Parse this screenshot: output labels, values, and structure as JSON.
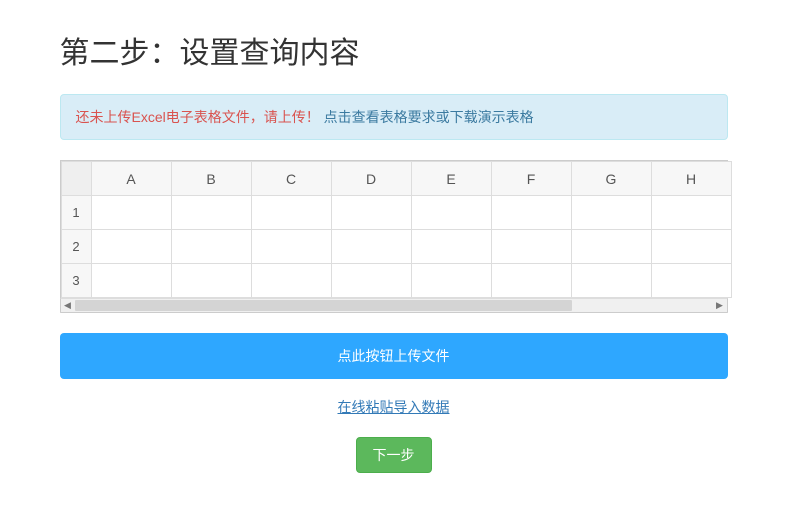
{
  "page": {
    "title": "第二步：设置查询内容"
  },
  "alert": {
    "warn_text": "还未上传Excel电子表格文件，请上传！",
    "link_text": "点击查看表格要求或下载演示表格"
  },
  "sheet": {
    "columns": [
      "A",
      "B",
      "C",
      "D",
      "E",
      "F",
      "G",
      "H"
    ],
    "rows": [
      "1",
      "2",
      "3"
    ]
  },
  "scrollbar": {
    "left_arrow": "◀",
    "right_arrow": "▶"
  },
  "buttons": {
    "upload_label": "点此按钮上传文件",
    "paste_link_label": "在线粘贴导入数据",
    "next_label": "下一步"
  }
}
